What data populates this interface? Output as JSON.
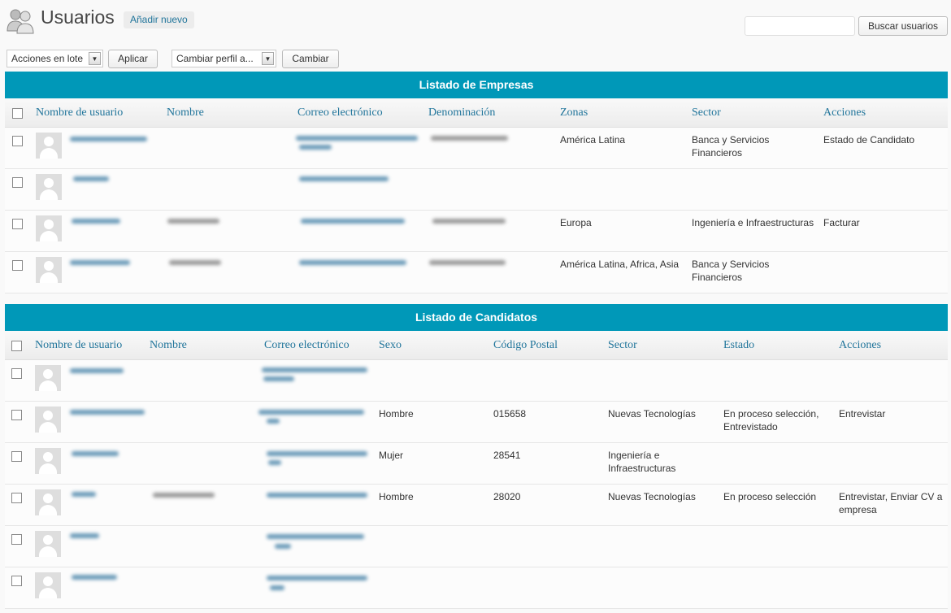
{
  "header": {
    "title": "Usuarios",
    "add_new": "Añadir nuevo",
    "search_value": "",
    "search_button": "Buscar usuarios"
  },
  "toolbar": {
    "bulk_select": "Acciones en lote",
    "apply": "Aplicar",
    "role_select": "Cambiar perfil a...",
    "change": "Cambiar"
  },
  "empresas": {
    "title": "Listado de Empresas",
    "columns": [
      "Nombre de usuario",
      "Nombre",
      "Correo electrónico",
      "Denominación",
      "Zonas",
      "Sector",
      "Acciones"
    ],
    "rows": [
      {
        "zonas": "América Latina",
        "sector": "Banca y Servicios Financieros",
        "acciones": "Estado de Candidato"
      },
      {
        "zonas": "",
        "sector": "",
        "acciones": ""
      },
      {
        "zonas": "Europa",
        "sector": "Ingeniería e Infraestructuras",
        "acciones": "Facturar"
      },
      {
        "zonas": "América Latina, Africa, Asia",
        "sector": "Banca y Servicios Financieros",
        "acciones": ""
      }
    ]
  },
  "candidatos": {
    "title": "Listado de Candidatos",
    "columns": [
      "Nombre de usuario",
      "Nombre",
      "Correo electrónico",
      "Sexo",
      "Código Postal",
      "Sector",
      "Estado",
      "Acciones"
    ],
    "rows": [
      {
        "sexo": "",
        "cp": "",
        "sector": "",
        "estado": "",
        "acciones": ""
      },
      {
        "sexo": "Hombre",
        "cp": "015658",
        "sector": "Nuevas Tecnologías",
        "estado": "En proceso selección, Entrevistado",
        "acciones": "Entrevistar"
      },
      {
        "sexo": "Mujer",
        "cp": "28541",
        "sector": "Ingeniería e Infraestructuras",
        "estado": "",
        "acciones": ""
      },
      {
        "sexo": "Hombre",
        "cp": "28020",
        "sector": "Nuevas Tecnologías",
        "estado": "En proceso selección",
        "acciones": "Entrevistar, Enviar CV a empresa"
      },
      {
        "sexo": "",
        "cp": "",
        "sector": "",
        "estado": "",
        "acciones": ""
      },
      {
        "sexo": "",
        "cp": "",
        "sector": "",
        "estado": "",
        "acciones": ""
      }
    ]
  },
  "colors": {
    "panel_header": "#0098b8",
    "link": "#21759b"
  }
}
